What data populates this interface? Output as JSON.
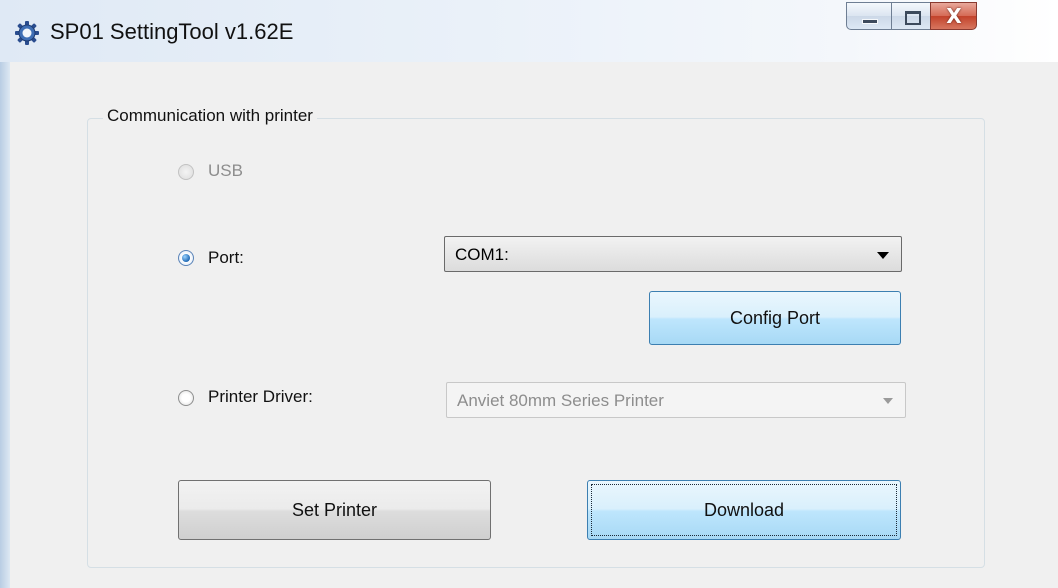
{
  "window": {
    "title": "SP01 SettingTool v1.62E",
    "icons": {
      "app": "gear-icon",
      "minimize": "minimize-icon",
      "maximize": "maximize-icon",
      "close": "close-icon"
    },
    "close_glyph": "X"
  },
  "group": {
    "title": "Communication with printer"
  },
  "options": {
    "usb": {
      "label": "USB",
      "checked": false,
      "enabled": false
    },
    "port": {
      "label": "Port:",
      "checked": true,
      "enabled": true
    },
    "printer_driver": {
      "label": "Printer Driver:",
      "checked": false,
      "enabled": true
    }
  },
  "port_select": {
    "value": "COM1:",
    "enabled": true
  },
  "driver_select": {
    "value": "Anviet 80mm Series Printer",
    "enabled": false
  },
  "buttons": {
    "config_port": "Config Port",
    "set_printer": "Set Printer",
    "download": "Download"
  },
  "colors": {
    "accent_blue": "#3c7fb1",
    "close_red": "#c2422b",
    "dialog_bg": "#f0f0f0"
  }
}
